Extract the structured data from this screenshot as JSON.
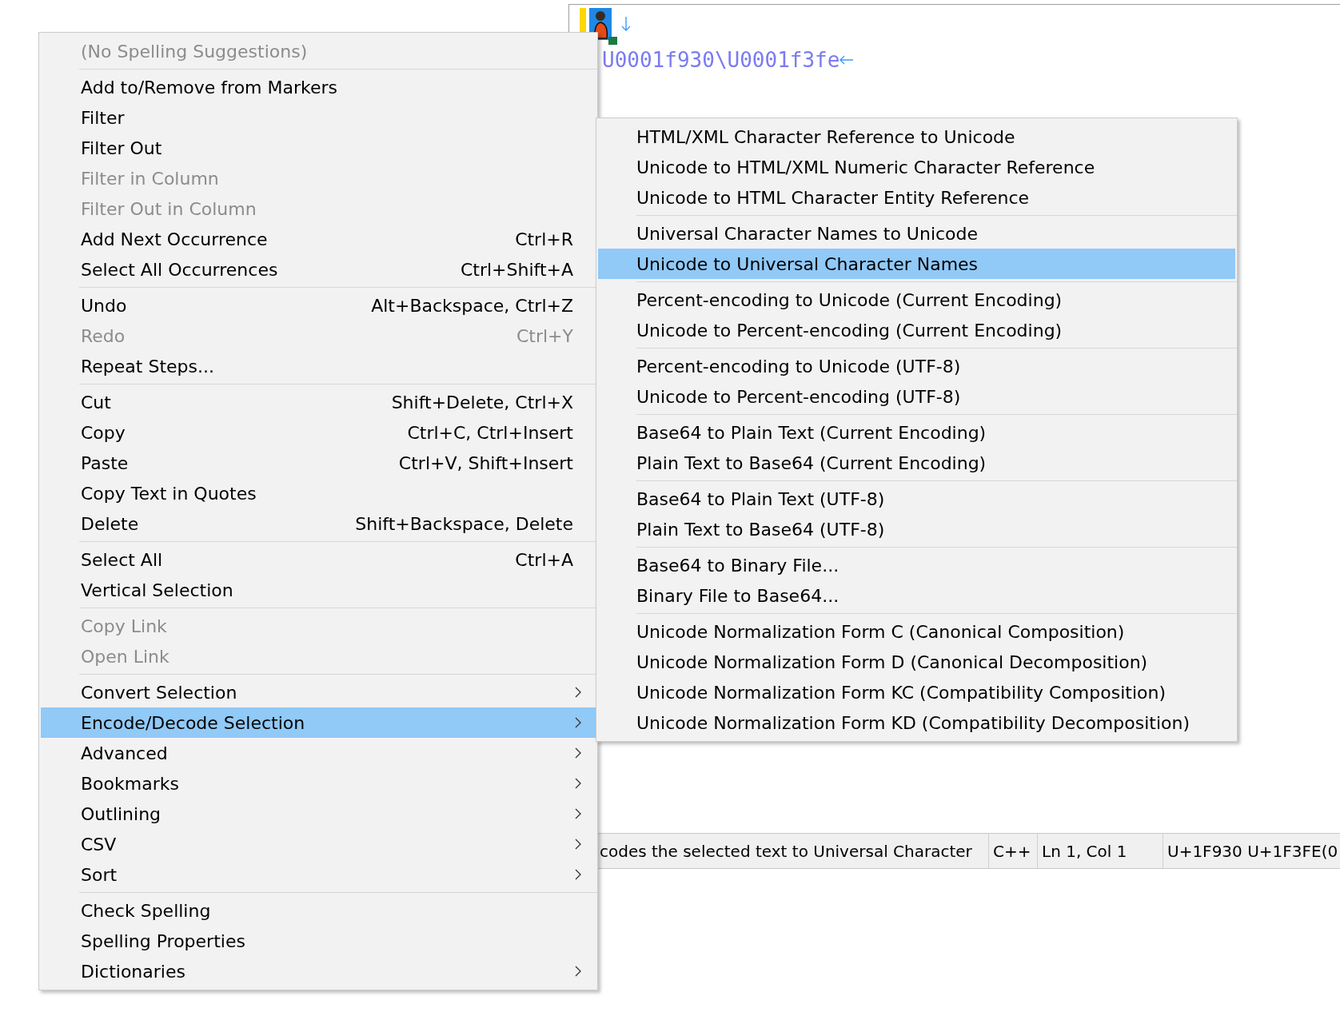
{
  "editor": {
    "text": "U0001f930\\U0001f3fe",
    "status_bar": [
      "codes the selected text to Universal Character",
      "C++",
      "Ln 1, Col 1",
      "U+1F930 U+1F3FE(0"
    ]
  },
  "context_menu": {
    "groups": [
      [
        {
          "label": "(No Spelling Suggestions)",
          "disabled": true,
          "selected": false,
          "submenu": false
        }
      ],
      [
        {
          "label": "Add to/Remove from Markers",
          "disabled": false,
          "selected": false,
          "submenu": false
        },
        {
          "label": "Filter",
          "disabled": false,
          "selected": false,
          "submenu": false
        },
        {
          "label": "Filter Out",
          "disabled": false,
          "selected": false,
          "submenu": false
        },
        {
          "label": "Filter in Column",
          "disabled": true,
          "selected": false,
          "submenu": false
        },
        {
          "label": "Filter Out in Column",
          "disabled": true,
          "selected": false,
          "submenu": false
        },
        {
          "label": "Add Next Occurrence",
          "shortcut": "Ctrl+R",
          "disabled": false,
          "selected": false,
          "submenu": false
        },
        {
          "label": "Select All Occurrences",
          "shortcut": "Ctrl+Shift+A",
          "disabled": false,
          "selected": false,
          "submenu": false
        }
      ],
      [
        {
          "label": "Undo",
          "shortcut": "Alt+Backspace, Ctrl+Z",
          "disabled": false,
          "selected": false,
          "submenu": false
        },
        {
          "label": "Redo",
          "shortcut": "Ctrl+Y",
          "disabled": true,
          "selected": false,
          "submenu": false
        },
        {
          "label": "Repeat Steps...",
          "disabled": false,
          "selected": false,
          "submenu": false
        }
      ],
      [
        {
          "label": "Cut",
          "shortcut": "Shift+Delete, Ctrl+X",
          "disabled": false,
          "selected": false,
          "submenu": false
        },
        {
          "label": "Copy",
          "shortcut": "Ctrl+C, Ctrl+Insert",
          "disabled": false,
          "selected": false,
          "submenu": false
        },
        {
          "label": "Paste",
          "shortcut": "Ctrl+V, Shift+Insert",
          "disabled": false,
          "selected": false,
          "submenu": false
        },
        {
          "label": "Copy Text in Quotes",
          "disabled": false,
          "selected": false,
          "submenu": false
        },
        {
          "label": "Delete",
          "shortcut": "Shift+Backspace, Delete",
          "disabled": false,
          "selected": false,
          "submenu": false
        }
      ],
      [
        {
          "label": "Select All",
          "shortcut": "Ctrl+A",
          "disabled": false,
          "selected": false,
          "submenu": false
        },
        {
          "label": "Vertical Selection",
          "disabled": false,
          "selected": false,
          "submenu": false
        }
      ],
      [
        {
          "label": "Copy Link",
          "disabled": true,
          "selected": false,
          "submenu": false
        },
        {
          "label": "Open Link",
          "disabled": true,
          "selected": false,
          "submenu": false
        }
      ],
      [
        {
          "label": "Convert Selection",
          "disabled": false,
          "selected": false,
          "submenu": true
        },
        {
          "label": "Encode/Decode Selection",
          "disabled": false,
          "selected": true,
          "submenu": true
        },
        {
          "label": "Advanced",
          "disabled": false,
          "selected": false,
          "submenu": true
        },
        {
          "label": "Bookmarks",
          "disabled": false,
          "selected": false,
          "submenu": true
        },
        {
          "label": "Outlining",
          "disabled": false,
          "selected": false,
          "submenu": true
        },
        {
          "label": "CSV",
          "disabled": false,
          "selected": false,
          "submenu": true
        },
        {
          "label": "Sort",
          "disabled": false,
          "selected": false,
          "submenu": true
        }
      ],
      [
        {
          "label": "Check Spelling",
          "disabled": false,
          "selected": false,
          "submenu": false
        },
        {
          "label": "Spelling Properties",
          "disabled": false,
          "selected": false,
          "submenu": false
        },
        {
          "label": "Dictionaries",
          "disabled": false,
          "selected": false,
          "submenu": true
        }
      ]
    ]
  },
  "submenu": {
    "groups": [
      [
        {
          "label": "HTML/XML Character Reference to Unicode",
          "selected": false
        },
        {
          "label": "Unicode to HTML/XML Numeric Character Reference",
          "selected": false
        },
        {
          "label": "Unicode to HTML Character Entity Reference",
          "selected": false
        }
      ],
      [
        {
          "label": "Universal Character Names to Unicode",
          "selected": false
        },
        {
          "label": "Unicode to Universal Character Names",
          "selected": true
        }
      ],
      [
        {
          "label": "Percent-encoding to Unicode (Current Encoding)",
          "selected": false
        },
        {
          "label": "Unicode to Percent-encoding (Current Encoding)",
          "selected": false
        }
      ],
      [
        {
          "label": "Percent-encoding to Unicode (UTF-8)",
          "selected": false
        },
        {
          "label": "Unicode to Percent-encoding (UTF-8)",
          "selected": false
        }
      ],
      [
        {
          "label": "Base64 to Plain Text (Current Encoding)",
          "selected": false
        },
        {
          "label": "Plain Text to Base64 (Current Encoding)",
          "selected": false
        }
      ],
      [
        {
          "label": "Base64 to Plain Text (UTF-8)",
          "selected": false
        },
        {
          "label": "Plain Text to Base64 (UTF-8)",
          "selected": false
        }
      ],
      [
        {
          "label": "Base64 to Binary File...",
          "selected": false
        },
        {
          "label": "Binary File to Base64...",
          "selected": false
        }
      ],
      [
        {
          "label": "Unicode Normalization Form C (Canonical Composition)",
          "selected": false
        },
        {
          "label": "Unicode Normalization Form D (Canonical Decomposition)",
          "selected": false
        },
        {
          "label": "Unicode Normalization Form KC (Compatibility Composition)",
          "selected": false
        },
        {
          "label": "Unicode Normalization Form KD (Compatibility Decomposition)",
          "selected": false
        }
      ]
    ]
  }
}
